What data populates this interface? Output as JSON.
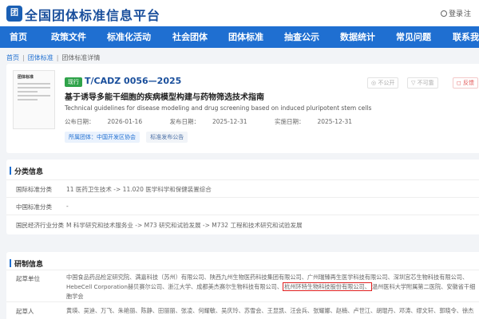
{
  "header": {
    "logo_text": "团",
    "site_title": "全国团体标准信息平台",
    "login": "登录",
    "register": "注"
  },
  "nav": [
    "首页",
    "政策文件",
    "标准化活动",
    "社会团体",
    "团体标准",
    "抽查公示",
    "数据统计",
    "常见问题",
    "联系我们"
  ],
  "breadcrumb": [
    "首页",
    "团体标准",
    "团体标准详情"
  ],
  "standard": {
    "status_badge": "现行",
    "code": "T/CADZ 0056—2025",
    "title_cn": "基于诱导多能干细胞的疾病模型构建与药物筛选技术指南",
    "title_en": "Technical guidelines for disease modeling and drug screening based on induced pluripotent stem cells",
    "publish_label": "公布日期：",
    "publish_date": "2026-01-16",
    "release_label": "发布日期：",
    "release_date": "2025-12-31",
    "implement_label": "实施日期：",
    "implement_date": "2025-12-31",
    "tag_org": "所属团体：中国开发区协会",
    "tag_notice": "标准发布公告",
    "thumb_title": "团体标准",
    "actions": {
      "public": "不公开",
      "help": "不可靠",
      "feedback": "反馈"
    }
  },
  "classification": {
    "section_title": "分类信息",
    "rows": [
      {
        "key": "国际标准分类",
        "value": "11 医药卫生技术 -> 11.020 医学科学和保健装置综合"
      },
      {
        "key": "中国标准分类",
        "value": "-"
      },
      {
        "key": "国民经济行业分类",
        "value": "M 科学研究和技术服务业 -> M73 研究和试验发展 -> M732 工程和技术研究和试验发展"
      }
    ]
  },
  "development": {
    "section_title": "研制信息",
    "drafting_units_label": "起草单位",
    "drafting_units_before": "中国食品药品检定研究院、满嘉科技（苏州）有限公司、陕西九州生物医药科技集团有限公司、广州瑞臻再生医学科技有限公司、深圳宫芯生物科技有限公司、HebeCell Corporation赫贝赛尔公司、浙江大学、成都美杰赛尔生物科技有限公司、",
    "drafting_units_highlight": "杭州环特生物科技股份有限公司、",
    "drafting_units_after": "温州医科大学附属第二医院、安徽省干细胞学会",
    "drafters_label": "起草人",
    "drafters": "黄瑛、吴迪、万飞、朱艳丽、陈静、田丽丽、张凌、何耀敏、吴庆玲、苏雪会、王显凯、汪会兵、张耀娜、赵楠、卢世江、胡琨丹、邓涛、缪文轩、郭晓令、徐杰"
  }
}
